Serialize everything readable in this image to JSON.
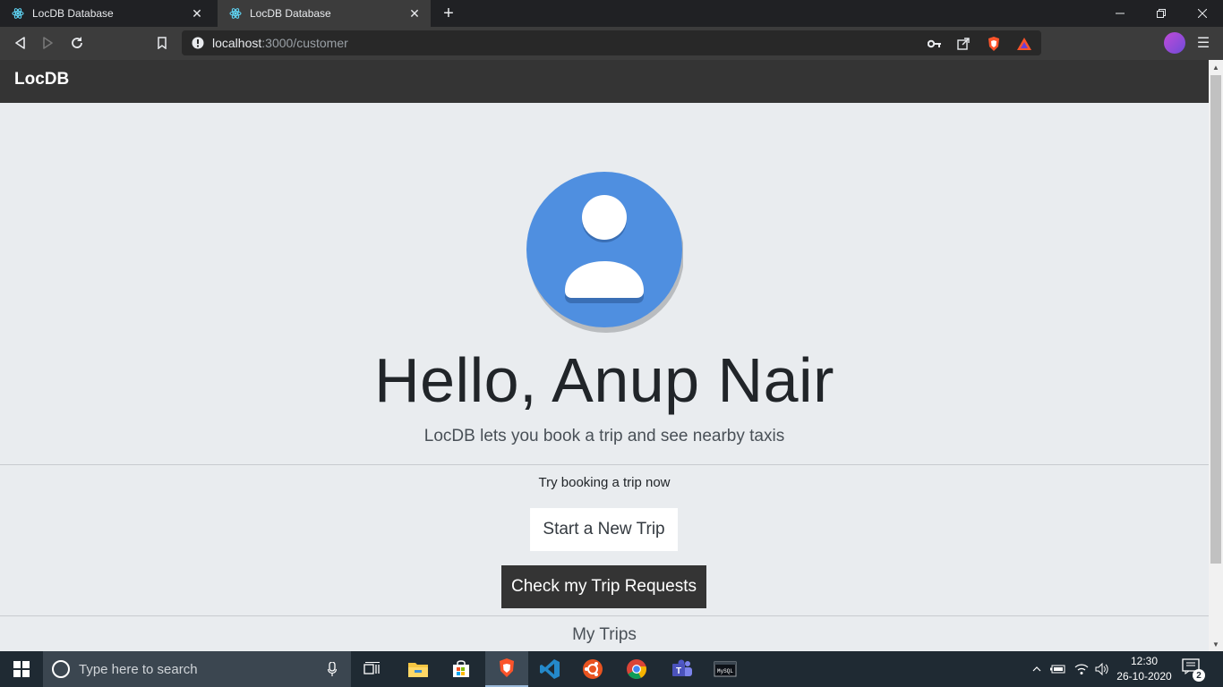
{
  "browser": {
    "tabs": [
      {
        "title": "LocDB Database"
      },
      {
        "title": "LocDB Database"
      }
    ],
    "url_host": "localhost",
    "url_rest": ":3000/customer"
  },
  "navbar": {
    "brand": "LocDB"
  },
  "hero": {
    "greeting": "Hello, Anup Nair",
    "lead": "LocDB lets you book a trip and see nearby taxis",
    "prompt": "Try booking a trip now",
    "new_trip_label": "Start a New Trip",
    "check_requests_label": "Check my Trip Requests",
    "my_trips_label": "My Trips"
  },
  "taskbar": {
    "search_placeholder": "Type here to search",
    "time": "12:30",
    "date": "26-10-2020",
    "notification_count": "2",
    "apps": [
      "task-view-icon",
      "file-explorer-icon",
      "store-icon",
      "brave-icon",
      "vscode-icon",
      "ubuntu-icon",
      "chrome-icon",
      "teams-icon",
      "mysql-icon"
    ]
  },
  "colors": {
    "navbar": "#343434",
    "page_bg": "#e9ecef",
    "avatar_blue": "#4f8fe0"
  }
}
